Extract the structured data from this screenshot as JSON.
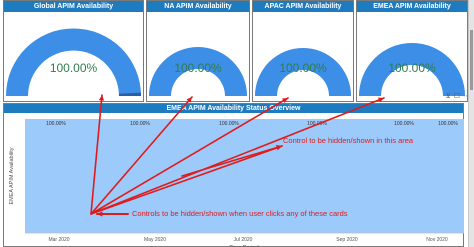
{
  "cards": [
    {
      "title": "Global APIM Availability",
      "value": "100.00%",
      "percent": 100
    },
    {
      "title": "NA APIM Availability",
      "value": "100.00%",
      "percent": 100
    },
    {
      "title": "APAC APIM Availability",
      "value": "100.00%",
      "percent": 100
    },
    {
      "title": "EMEA APIM Availability",
      "value": "100.00%",
      "percent": 100
    }
  ],
  "panel": {
    "title": "EMEA APIM Availability Status Overview"
  },
  "chart_data": {
    "type": "area",
    "ylabel": "EMEA APIM Availability",
    "xlabel": "Time Period",
    "x": [
      "Mar 2020",
      "May 2020",
      "Jul 2020",
      "Sep 2020",
      "Nov 2020"
    ],
    "xticks": [
      "Mar 2020",
      "May 2020",
      "Jul 2020",
      "Sep 2020",
      "Nov 2020"
    ],
    "data_labels": [
      "100.00%",
      "100.00%",
      "100.00%",
      "100.00%",
      "100.00%",
      "100.00%"
    ],
    "series": [
      {
        "values": [
          100,
          100,
          100,
          100,
          100,
          100
        ]
      }
    ],
    "fill_color": "#9ccafb",
    "grid": false
  },
  "annotations": {
    "upper": "Control to be hidden/shown in this area",
    "lower": "Controls to be hidden/shown when user clicks any of these cards"
  },
  "colors": {
    "title_bar": "#1f7bbf",
    "gauge_fill": "#3c8ee7",
    "gauge_track": "#d8d8d8",
    "gauge_tip": "#2a5fa8",
    "value_text": "#2f7d4f",
    "annotation": "#e01b1b"
  },
  "icons": [
    "filter-icon",
    "focus-mode-icon",
    "more-options-icon"
  ]
}
